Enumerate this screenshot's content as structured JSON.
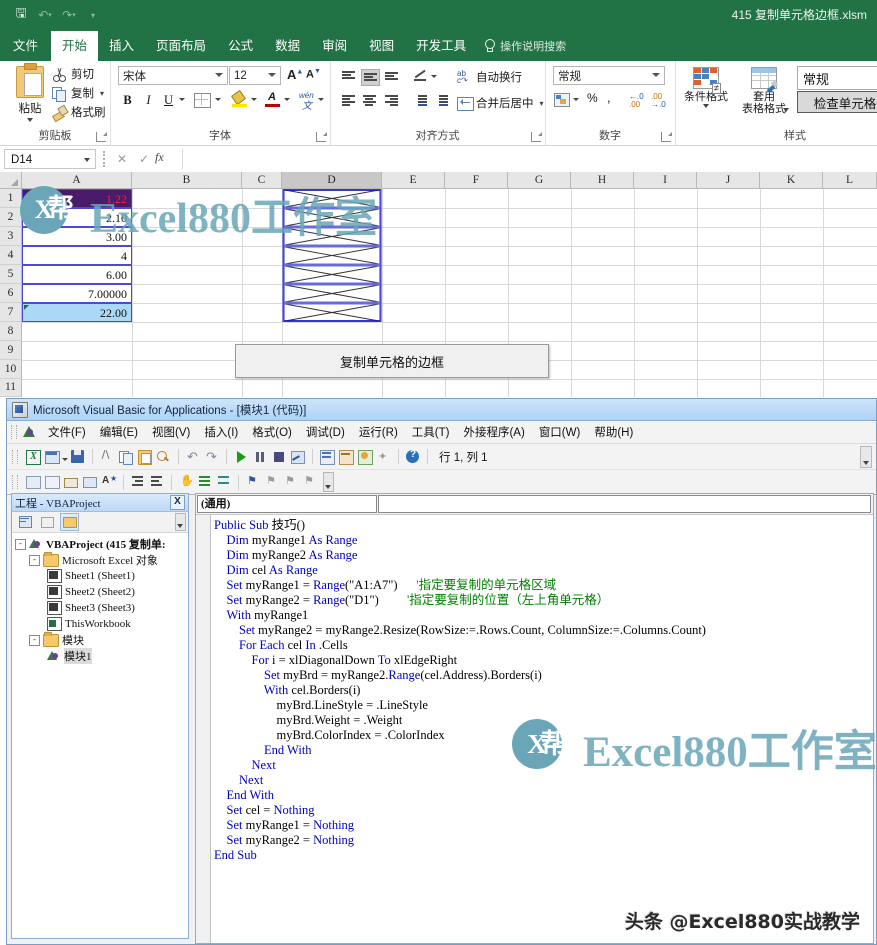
{
  "excel": {
    "title_bar": {
      "document_title": "415 复制单元格边框.xlsm",
      "qat": [
        {
          "name": "save-icon",
          "glyph": "⬒"
        },
        {
          "name": "undo-icon",
          "glyph": "↶"
        },
        {
          "name": "redo-icon",
          "glyph": "↷"
        },
        {
          "name": "customize-qat-icon",
          "glyph": "▾"
        }
      ]
    },
    "tabs": [
      {
        "label": "文件",
        "active": false
      },
      {
        "label": "开始",
        "active": true
      },
      {
        "label": "插入",
        "active": false
      },
      {
        "label": "页面布局",
        "active": false
      },
      {
        "label": "公式",
        "active": false
      },
      {
        "label": "数据",
        "active": false
      },
      {
        "label": "审阅",
        "active": false
      },
      {
        "label": "视图",
        "active": false
      },
      {
        "label": "开发工具",
        "active": false
      }
    ],
    "tell_me": "操作说明搜索",
    "ribbon": {
      "groups": [
        {
          "label": "剪贴板"
        },
        {
          "label": "字体"
        },
        {
          "label": "对齐方式"
        },
        {
          "label": "数字"
        },
        {
          "label": "样式"
        }
      ],
      "clipboard": {
        "paste": "粘贴",
        "cut": "剪切",
        "copy": "复制",
        "format_painter": "格式刷"
      },
      "font": {
        "font_name": "宋体",
        "font_size": "12",
        "bold": "B",
        "italic": "I",
        "underline": "U",
        "grow_font": "A",
        "shrink_font": "A"
      },
      "alignment": {
        "wrap_text": "自动换行",
        "merge_center": "合并后居中"
      },
      "number": {
        "format": "常规",
        "percent": "%",
        "comma": ",",
        "increase_decimal": "00",
        "decrease_decimal": "00"
      },
      "styles": {
        "conditional_format": "条件格式",
        "format_as_table": "套用\n表格格式",
        "cell_style_normal": "常规",
        "cell_style_check": "检查单元格"
      }
    },
    "formula_bar": {
      "name_box": "D14",
      "cancel_icon": "✕",
      "confirm_icon": "✓",
      "fx_icon": "fx",
      "formula_value": ""
    },
    "grid": {
      "columns": [
        "A",
        "B",
        "C",
        "D",
        "E",
        "F",
        "G",
        "H",
        "I",
        "J",
        "K",
        "L"
      ],
      "selected_column": "D",
      "rows": [
        "1",
        "2",
        "3",
        "4",
        "5",
        "6",
        "7",
        "8",
        "9",
        "10",
        "11"
      ],
      "source_cells": [
        {
          "row": 1,
          "value": "1.22"
        },
        {
          "row": 2,
          "value": "2.10"
        },
        {
          "row": 3,
          "value": "3.00"
        },
        {
          "row": 4,
          "value": "4"
        },
        {
          "row": 5,
          "value": "6.00"
        },
        {
          "row": 6,
          "value": "7.00000"
        },
        {
          "row": 7,
          "value": "22.00"
        }
      ],
      "source_range_label": "A1:A7",
      "dest_range_label": "D1:D7",
      "run_button_label": "复制单元格的边框"
    }
  },
  "vbe": {
    "window_title": "Microsoft Visual Basic for Applications - [模块1 (代码)]",
    "menu": [
      "文件(F)",
      "编辑(E)",
      "视图(V)",
      "插入(I)",
      "格式(O)",
      "调试(D)",
      "运行(R)",
      "工具(T)",
      "外接程序(A)",
      "窗口(W)",
      "帮助(H)"
    ],
    "toolbar_position": "行 1, 列 1",
    "project_explorer": {
      "title": "工程 - VBAProject",
      "close_label": "X",
      "tree": [
        {
          "depth": 0,
          "label": "VBAProject (415 复制单:",
          "icon": "vbproject-icon",
          "expander": "-",
          "bold": true
        },
        {
          "depth": 1,
          "label": "Microsoft Excel 对象",
          "icon": "folder-icon",
          "expander": "-",
          "bold": false
        },
        {
          "depth": 2,
          "label": "Sheet1 (Sheet1)",
          "icon": "sheet-icon",
          "expander": "",
          "bold": false
        },
        {
          "depth": 2,
          "label": "Sheet2 (Sheet2)",
          "icon": "sheet-icon",
          "expander": "",
          "bold": false
        },
        {
          "depth": 2,
          "label": "Sheet3 (Sheet3)",
          "icon": "sheet-icon",
          "expander": "",
          "bold": false
        },
        {
          "depth": 2,
          "label": "ThisWorkbook",
          "icon": "workbook-icon",
          "expander": "",
          "bold": false
        },
        {
          "depth": 1,
          "label": "模块",
          "icon": "folder-icon",
          "expander": "-",
          "bold": false
        },
        {
          "depth": 2,
          "label": "模块1",
          "icon": "module-icon",
          "expander": "",
          "bold": false,
          "selected": true
        }
      ]
    },
    "code_pane": {
      "object_combo": "(通用)",
      "proc_combo": "",
      "code": "Public Sub 技巧()\n    Dim myRange1 As Range\n    Dim myRange2 As Range\n    Dim cel As Range\n    Set myRange1 = Range(\"A1:A7\")      '指定要复制的单元格区域\n    Set myRange2 = Range(\"D1\")         '指定要复制的位置（左上角单元格）\n    With myRange1\n        Set myRange2 = myRange2.Resize(RowSize:=.Rows.Count, ColumnSize:=.Columns.Count)\n        For Each cel In .Cells\n            For i = xlDiagonalDown To xlEdgeRight\n                Set myBrd = myRange2.Range(cel.Address).Borders(i)\n                With cel.Borders(i)\n                    myBrd.LineStyle = .LineStyle\n                    myBrd.Weight = .Weight\n                    myBrd.ColorIndex = .ColorIndex\n                End With\n            Next\n        Next\n    End With\n    Set cel = Nothing\n    Set myRange1 = Nothing\n    Set myRange2 = Nothing\nEnd Sub"
    }
  },
  "watermarks": {
    "logo_letter": "X",
    "logo_cn": "帮",
    "brand_top": "Excel880工作室",
    "brand_mid": "Excel880工作室",
    "footer": "头条 @Excel880实战教学"
  },
  "colors": {
    "excel_green": "#217346",
    "selection_blue": "#4a4ad8",
    "watermark_teal": "#6aa6b8",
    "vbe_keyword": "#0000c0",
    "vbe_comment": "#008000",
    "cell_a1_fill": "#4a1a6b",
    "cell_a7_fill": "#aad8f5"
  }
}
